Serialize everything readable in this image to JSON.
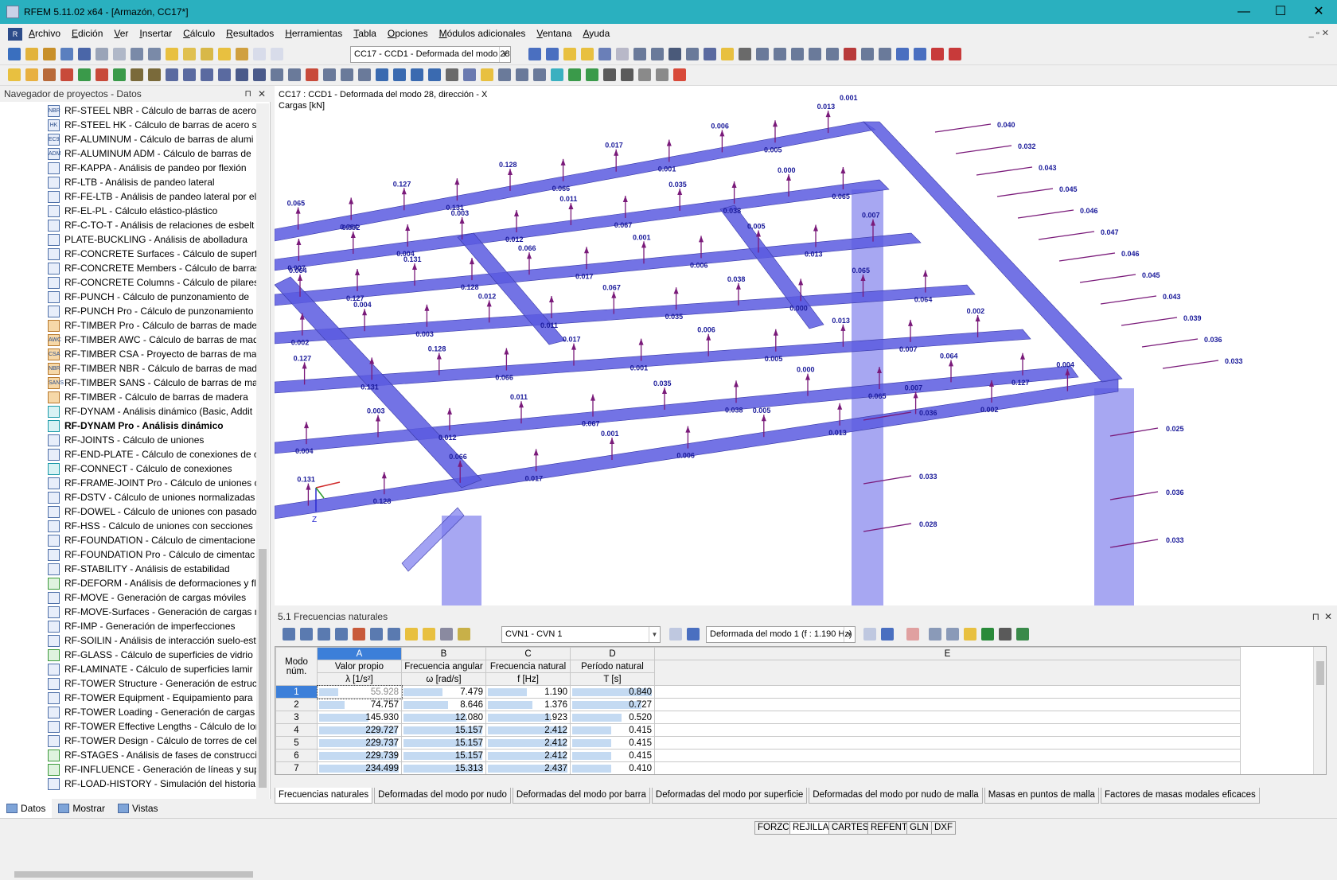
{
  "window": {
    "title": "RFEM 5.11.02 x64 - [Armazón, CC17*]",
    "minimize": "—",
    "maximize": "☐",
    "close": "✕"
  },
  "menu": {
    "items": [
      "Archivo",
      "Edición",
      "Ver",
      "Insertar",
      "Cálculo",
      "Resultados",
      "Herramientas",
      "Tabla",
      "Opciones",
      "Módulos adicionales",
      "Ventana",
      "Ayuda"
    ],
    "controls": "_ ▫ ✕"
  },
  "toolbar": {
    "loadcase_combo": "CC17 - CCD1 - Deformada del modo 28"
  },
  "navigator": {
    "title": "Navegador de proyectos - Datos",
    "pin": "⊓",
    "close": "✕",
    "items": [
      {
        "label": "RF-STEEL NBR - Cálculo de barras de acero s",
        "tag": "NBR"
      },
      {
        "label": "RF-STEEL HK - Cálculo de barras de acero se",
        "tag": "HK"
      },
      {
        "label": "RF-ALUMINUM - Cálculo de barras de alumi",
        "tag": "EC9"
      },
      {
        "label": "RF-ALUMINUM ADM - Cálculo de barras de",
        "tag": "ADM"
      },
      {
        "label": "RF-KAPPA - Análisis de pandeo por flexión",
        "tag": ""
      },
      {
        "label": "RF-LTB - Análisis de pandeo lateral",
        "tag": ""
      },
      {
        "label": "RF-FE-LTB - Análisis de pandeo lateral por el",
        "tag": ""
      },
      {
        "label": "RF-EL-PL - Cálculo elástico-plástico",
        "tag": ""
      },
      {
        "label": "RF-C-TO-T - Análisis de relaciones de esbelt",
        "tag": ""
      },
      {
        "label": "PLATE-BUCKLING - Análisis de abolladura",
        "tag": ""
      },
      {
        "label": "RF-CONCRETE Surfaces - Cálculo de superfic",
        "tag": ""
      },
      {
        "label": "RF-CONCRETE Members - Cálculo de barras",
        "tag": ""
      },
      {
        "label": "RF-CONCRETE Columns - Cálculo de pilares",
        "tag": ""
      },
      {
        "label": "RF-PUNCH - Cálculo de punzonamiento de",
        "tag": ""
      },
      {
        "label": "RF-PUNCH Pro - Cálculo de punzonamiento",
        "tag": ""
      },
      {
        "label": "RF-TIMBER Pro - Cálculo de barras de mader",
        "tag": ""
      },
      {
        "label": "RF-TIMBER AWC - Cálculo de barras de mad",
        "tag": "AWC"
      },
      {
        "label": "RF-TIMBER CSA - Proyecto de barras de mac",
        "tag": "CSA"
      },
      {
        "label": "RF-TIMBER NBR - Cálculo de barras de made",
        "tag": "NBR"
      },
      {
        "label": "RF-TIMBER SANS - Cálculo de barras de mac",
        "tag": "SANS"
      },
      {
        "label": "RF-TIMBER - Cálculo de barras de madera",
        "tag": ""
      },
      {
        "label": "RF-DYNAM - Análisis dinámico (Basic, Addit",
        "tag": ""
      },
      {
        "label": "RF-DYNAM Pro - Análisis dinámico",
        "tag": ""
      },
      {
        "label": "RF-JOINTS - Cálculo de uniones",
        "tag": ""
      },
      {
        "label": "RF-END-PLATE - Cálculo de conexiones de c",
        "tag": ""
      },
      {
        "label": "RF-CONNECT - Cálculo de conexiones",
        "tag": ""
      },
      {
        "label": "RF-FRAME-JOINT Pro - Cálculo de uniones c",
        "tag": ""
      },
      {
        "label": "RF-DSTV - Cálculo de uniones normalizadas",
        "tag": ""
      },
      {
        "label": "RF-DOWEL - Cálculo de uniones con pasado",
        "tag": ""
      },
      {
        "label": "RF-HSS - Cálculo de uniones con secciones h",
        "tag": ""
      },
      {
        "label": "RF-FOUNDATION - Cálculo de cimentacione",
        "tag": ""
      },
      {
        "label": "RF-FOUNDATION Pro - Cálculo de cimentac",
        "tag": ""
      },
      {
        "label": "RF-STABILITY - Análisis de estabilidad",
        "tag": ""
      },
      {
        "label": "RF-DEFORM - Análisis de deformaciones y fl",
        "tag": ""
      },
      {
        "label": "RF-MOVE - Generación de cargas móviles",
        "tag": ""
      },
      {
        "label": "RF-MOVE-Surfaces - Generación de cargas n",
        "tag": ""
      },
      {
        "label": "RF-IMP - Generación de imperfecciones",
        "tag": ""
      },
      {
        "label": "RF-SOILIN - Análisis de interacción suelo-est",
        "tag": ""
      },
      {
        "label": "RF-GLASS - Cálculo de superficies de vidrio",
        "tag": ""
      },
      {
        "label": "RF-LAMINATE - Cálculo de superficies lamir",
        "tag": ""
      },
      {
        "label": "RF-TOWER Structure - Generación de estruct",
        "tag": ""
      },
      {
        "label": "RF-TOWER Equipment - Equipamiento para",
        "tag": ""
      },
      {
        "label": "RF-TOWER Loading - Generación de cargas p",
        "tag": ""
      },
      {
        "label": "RF-TOWER Effective Lengths - Cálculo de lor",
        "tag": ""
      },
      {
        "label": "RF-TOWER Design - Cálculo de torres de cel",
        "tag": ""
      },
      {
        "label": "RF-STAGES - Análisis de fases de construcció",
        "tag": ""
      },
      {
        "label": "RF-INFLUENCE - Generación de líneas y supe",
        "tag": ""
      },
      {
        "label": "RF-LOAD-HISTORY - Simulación del historia",
        "tag": ""
      }
    ],
    "tabs": [
      "Datos",
      "Mostrar",
      "Vistas"
    ]
  },
  "view": {
    "line1": "CC17 : CCD1 - Deformada del modo 28, dirección - X",
    "line2": "Cargas [kN]",
    "labels_top": [
      "0.001",
      "0.000",
      "0.040",
      "0.032",
      "0.043",
      "0.045",
      "0.046",
      "0.047",
      "0.046",
      "0.045",
      "0.043",
      "0.039",
      "0.036",
      "0.033",
      "0.028",
      "0.025"
    ],
    "labels_misc": [
      "0.065",
      "0.064",
      "0.127",
      "0.131",
      "0.128",
      "0.066",
      "0.017",
      "0.001",
      "0.006",
      "0.005",
      "0.013",
      "0.007",
      "0.002",
      "0.004",
      "0.003",
      "0.012",
      "0.011",
      "0.067",
      "0.035",
      "0.038",
      "0.000"
    ],
    "axis_z": "Z"
  },
  "panel": {
    "title": "5.1 Frecuencias naturales",
    "pin": "⊓",
    "close": "✕",
    "cvn_combo": "CVN1 - CVN 1",
    "mode_combo": "Deformada del modo 1 (f : 1.190 Hz)"
  },
  "table": {
    "col_letters": [
      "A",
      "B",
      "C",
      "D",
      "E"
    ],
    "head1": [
      "Modo",
      "Valor propio",
      "Frecuencia angular",
      "Frecuencia natural",
      "Período natural"
    ],
    "head2": [
      "núm.",
      "λ [1/s²]",
      "ω [rad/s]",
      "f [Hz]",
      "T [s]"
    ],
    "rows": [
      {
        "n": "1",
        "a": "55.928",
        "b": "7.479",
        "c": "1.190",
        "d": "0.840"
      },
      {
        "n": "2",
        "a": "74.757",
        "b": "8.646",
        "c": "1.376",
        "d": "0.727"
      },
      {
        "n": "3",
        "a": "145.930",
        "b": "12.080",
        "c": "1.923",
        "d": "0.520"
      },
      {
        "n": "4",
        "a": "229.727",
        "b": "15.157",
        "c": "2.412",
        "d": "0.415"
      },
      {
        "n": "5",
        "a": "229.737",
        "b": "15.157",
        "c": "2.412",
        "d": "0.415"
      },
      {
        "n": "6",
        "a": "229.739",
        "b": "15.157",
        "c": "2.412",
        "d": "0.415"
      },
      {
        "n": "7",
        "a": "234.499",
        "b": "15.313",
        "c": "2.437",
        "d": "0.410"
      }
    ]
  },
  "bottom_tabs": [
    "Frecuencias naturales",
    "Deformadas del modo por nudo",
    "Deformadas del modo por barra",
    "Deformadas del modo por superficie",
    "Deformadas del modo por nudo de malla",
    "Masas en puntos de malla",
    "Factores de masas modales eficaces"
  ],
  "status": [
    "FORZC",
    "REJILLA",
    "CARTES",
    "REFENT",
    "GLN",
    "DXF"
  ],
  "colors": {
    "titlebar": "#2ab0bf",
    "beam": "#5a5ae0",
    "load_arrow": "#7a1a7a",
    "label": "#1a1a9a",
    "selection": "#3c7fd9"
  }
}
